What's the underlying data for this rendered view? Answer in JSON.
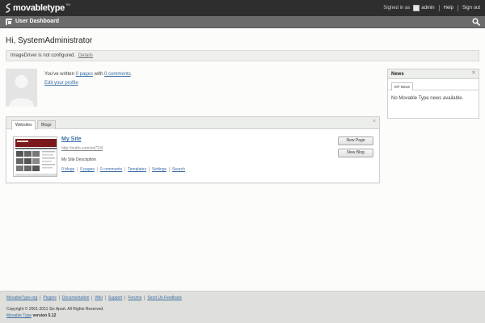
{
  "header": {
    "logo_text": "movabletype",
    "logo_tm": "TM",
    "signed_in_as": "Signed in as",
    "username": "admin",
    "help": "Help",
    "sign_out": "Sign out"
  },
  "subbar": {
    "title": "User Dashboard",
    "icon": "dashboard-icon",
    "search_icon": "search-icon"
  },
  "greeting": "Hi, SystemAdministrator",
  "notice": {
    "text": "ImageDriver is not configured.",
    "link": "Details"
  },
  "profile": {
    "written_prefix": "You've written",
    "pages_link": "0 pages",
    "with": "with",
    "comments_link": "0 comments",
    "period": ".",
    "edit_link": "Edit your profile"
  },
  "websites_panel": {
    "tabs": [
      "Websites",
      "Blogs"
    ],
    "close": "×",
    "site": {
      "name": "My Site",
      "url": "http://nufto.com/mt719/",
      "description": "My Site Description",
      "links": [
        "0 blogs",
        "0 pages",
        "0 comments",
        "Templates",
        "Settings",
        "Search"
      ]
    },
    "buttons": {
      "new_page": "New Page",
      "new_blog": "New Blog"
    }
  },
  "news": {
    "title": "News",
    "close": "×",
    "tab": "MT News",
    "body": "No Movable Type news available."
  },
  "footer": {
    "links": [
      "MovableType.org",
      "Plugins",
      "Documentation",
      "Wiki",
      "Support",
      "Forums",
      "Send Us Feedback"
    ],
    "copyright": "Copyright © 2001-2011 Six Apart. All Rights Reserved.",
    "product_link": "Movable Type",
    "version_label": "version 5.12"
  },
  "colors": {
    "topbar": "#2e2e2e",
    "subbar": "#6b6b6b",
    "link": "#3b6ea5"
  }
}
